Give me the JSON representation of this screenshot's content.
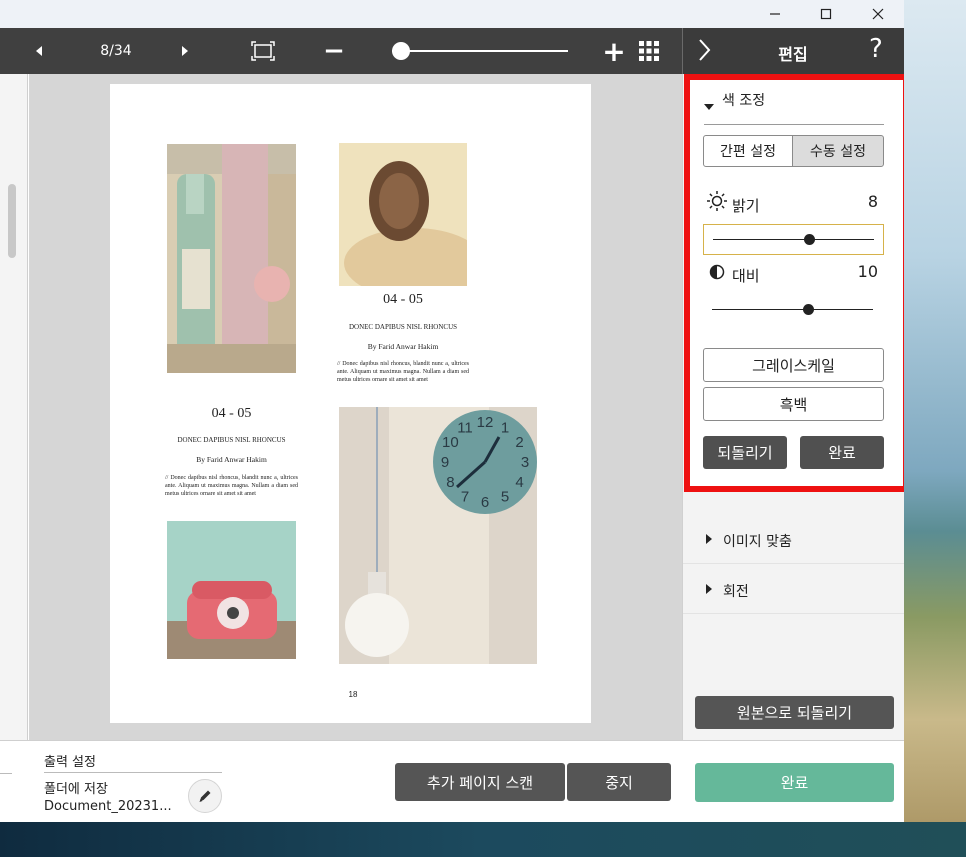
{
  "window_controls": {
    "minimize": "—",
    "maximize": "☐",
    "close": "✕"
  },
  "toolbar": {
    "page_indicator": "8/34",
    "zoom_out": "−",
    "zoom_in": "+",
    "zoom_level": 0.05
  },
  "panel": {
    "title": "편집",
    "help": "?",
    "collapse": "›"
  },
  "document": {
    "heading_right": "04 - 05",
    "subtitle_right": "DONEC DAPIBUS NISL RHONCUS",
    "byline_right": "By Farid Anwar Hakim",
    "body_right": "// Donec dapibus nisl rhoncus, blandit nunc a, ultrices ante. Aliquam ut maximus magna. Nullam a diam sed metus ultrices ornare sit amet sit amet",
    "heading_left": "04 - 05",
    "subtitle_left": "DONEC DAPIBUS NISL RHONCUS",
    "byline_left": "By Farid Anwar Hakim",
    "body_left": "// Donec dapibus nisl rhoncus, blandit nunc a, ultrices ante. Aliquam ut maximus magna. Nullam a diam sed metus ultrices ornare sit amet sit amet",
    "page_number": "18",
    "clock_numbers": [
      "12",
      "1",
      "2",
      "3",
      "4",
      "5",
      "6",
      "7",
      "8",
      "9",
      "10",
      "11"
    ]
  },
  "color_adjust": {
    "section_title": "색 조정",
    "tab_easy": "간편 설정",
    "tab_manual": "수동 설정",
    "brightness_label": "밝기",
    "brightness_value": "8",
    "brightness_level": 0.6,
    "contrast_label": "대비",
    "contrast_value": "10",
    "contrast_level": 0.6,
    "grayscale": "그레이스케일",
    "black_white": "흑백",
    "revert": "되돌리기",
    "done": "완료"
  },
  "sections": {
    "image_fit": "이미지 맞춤",
    "rotate": "회전"
  },
  "revert_original": "원본으로 되돌리기",
  "output": {
    "title": "출력 설정",
    "save_to": "폴더에 저장",
    "filename": "Document_20231..."
  },
  "actions": {
    "add_scan": "추가 페이지 스캔",
    "stop": "중지",
    "finish": "완료"
  },
  "colors": {
    "accent_red": "#ee1111",
    "finish_green": "#65b89a",
    "toolbar": "#404040"
  }
}
